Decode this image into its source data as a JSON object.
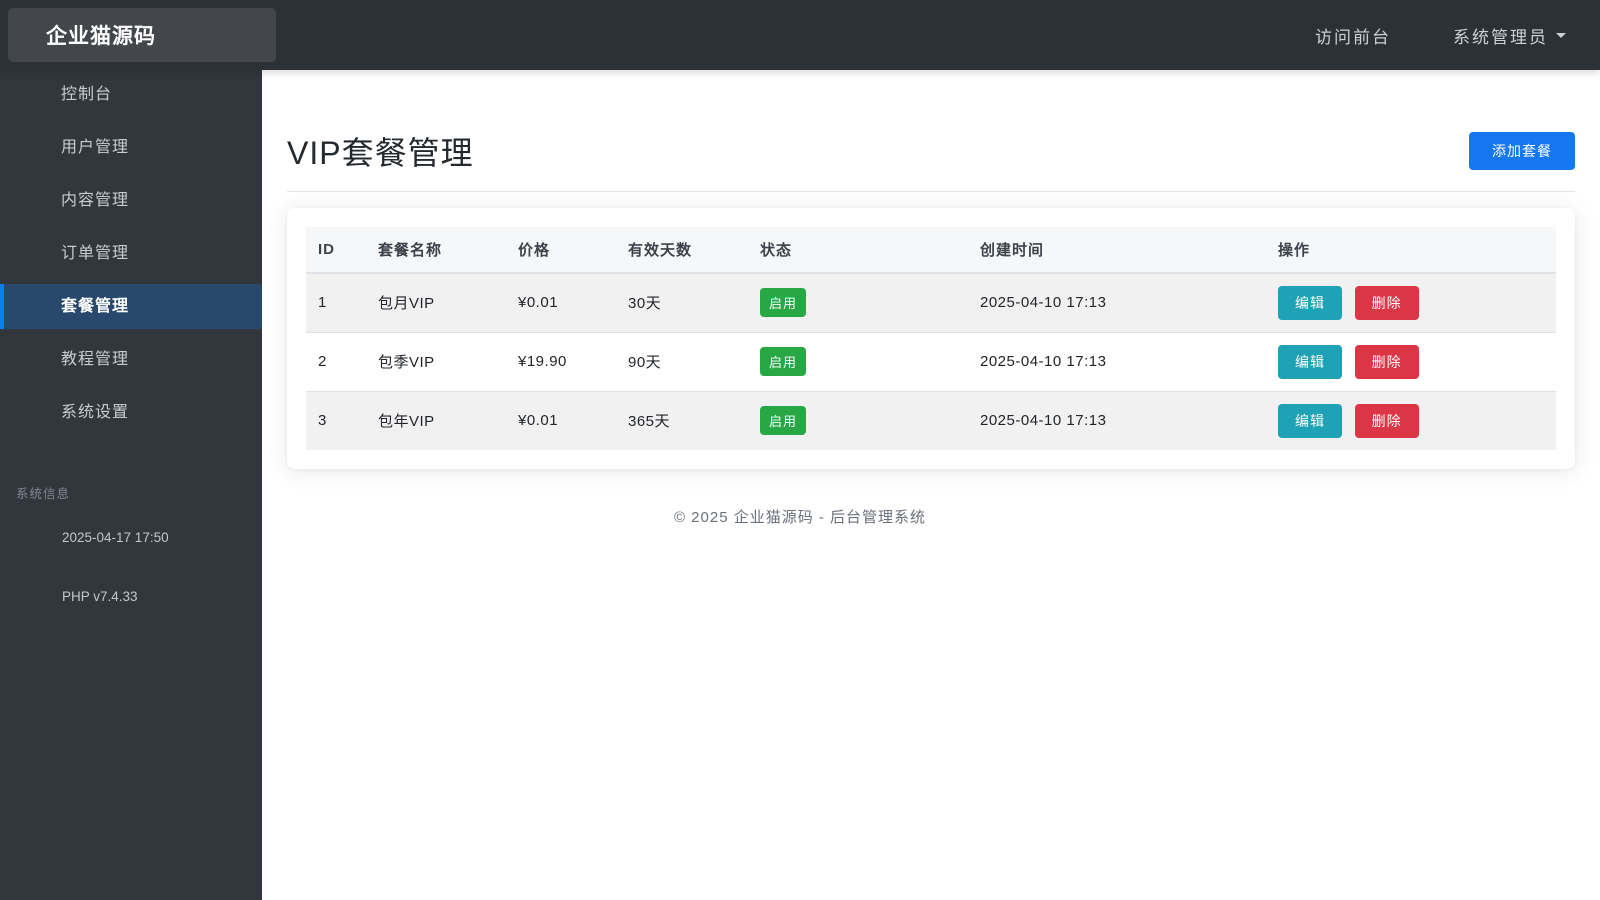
{
  "brand": {
    "logo": "企业猫源码"
  },
  "navbar": {
    "links": [
      {
        "label": "访问前台"
      },
      {
        "label": "系统管理员"
      }
    ]
  },
  "sidebar": {
    "items": [
      {
        "label": "控制台",
        "active": false
      },
      {
        "label": "用户管理",
        "active": false
      },
      {
        "label": "内容管理",
        "active": false
      },
      {
        "label": "订单管理",
        "active": false
      },
      {
        "label": "套餐管理",
        "active": true
      },
      {
        "label": "教程管理",
        "active": false
      },
      {
        "label": "系统设置",
        "active": false
      }
    ],
    "section_title": "系统信息",
    "info": [
      {
        "text": "2025-04-17 17:50"
      },
      {
        "text": "PHP v7.4.33"
      }
    ]
  },
  "main": {
    "title": "VIP套餐管理",
    "add_button_label": "添加套餐",
    "table": {
      "headers": [
        "ID",
        "套餐名称",
        "价格",
        "有效天数",
        "状态",
        "创建时间",
        "操作"
      ],
      "rows": [
        {
          "id": "1",
          "name": "包月VIP",
          "price": "¥0.01",
          "days": "30天",
          "status": "启用",
          "created": "2025-04-10 17:13"
        },
        {
          "id": "2",
          "name": "包季VIP",
          "price": "¥19.90",
          "days": "90天",
          "status": "启用",
          "created": "2025-04-10 17:13"
        },
        {
          "id": "3",
          "name": "包年VIP",
          "price": "¥0.01",
          "days": "365天",
          "status": "启用",
          "created": "2025-04-10 17:13"
        }
      ],
      "actions": {
        "edit": "编辑",
        "delete": "删除"
      }
    }
  },
  "footer": {
    "text": "© 2025 企业猫源码 - 后台管理系统"
  },
  "colors": {
    "navbar_bg": "#2c3137",
    "sidebar_bg": "#32373d",
    "logo_box_bg": "#43474c",
    "active_item_bg": "#29496c",
    "active_item_border": "#0d7df2",
    "primary_button": "#1577f2",
    "status_enabled": "#28a745",
    "edit_button": "#1fa2b5",
    "delete_button": "#dc3545"
  }
}
